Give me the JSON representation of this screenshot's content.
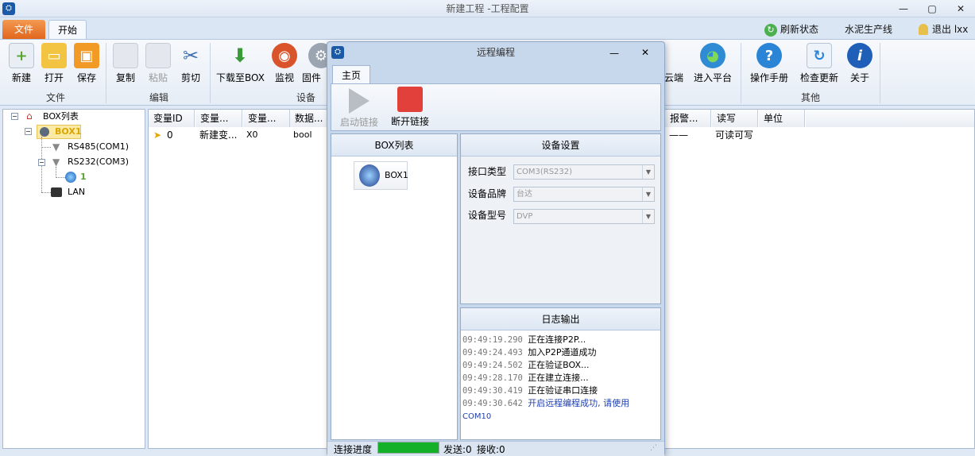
{
  "window": {
    "title": "新建工程 -工程配置"
  },
  "tabs": {
    "file": "文件",
    "start": "开始"
  },
  "right_links": {
    "refresh": "刷新状态",
    "line": "水泥生产线",
    "logout": "退出 lxx"
  },
  "ribbon": {
    "new": "新建",
    "open": "打开",
    "save": "保存",
    "copy": "复制",
    "paste": "粘贴",
    "cut": "剪切",
    "download": "下载至BOX",
    "monitor": "监视",
    "firmware": "固件",
    "cloud": "云端",
    "enter_platform": "进入平台",
    "manual": "操作手册",
    "check_update": "检查更新",
    "about": "关于",
    "group_file": "文件",
    "group_edit": "编辑",
    "group_device": "设备",
    "group_other": "其他"
  },
  "tree": {
    "root": "BOX列表",
    "box1": "BOX1",
    "rs485": "RS485(COM1)",
    "rs232": "RS232(COM3)",
    "device1": "1",
    "lan": "LAN"
  },
  "table": {
    "headers": [
      "变量ID",
      "变量...",
      "变量...",
      "数据...",
      "报警...",
      "读写",
      "单位"
    ],
    "row": {
      "id": "0",
      "name": "新建变...",
      "addr": "X0",
      "type": "bool",
      "alarm": "——",
      "rw": "可读可写"
    }
  },
  "dialog": {
    "title": "远程编程",
    "tab": "主页",
    "start_link": "启动链接",
    "stop_link": "断开链接",
    "box_list_title": "BOX列表",
    "box_item": "BOX1",
    "settings_title": "设备设置",
    "port_label": "接口类型",
    "port_value": "COM3(RS232)",
    "brand_label": "设备品牌",
    "brand_value": "台达",
    "model_label": "设备型号",
    "model_value": "DVP",
    "log_title": "日志输出",
    "logs": [
      {
        "time": "09:49:19.290",
        "msg": "正在连接P2P..."
      },
      {
        "time": "09:49:24.493",
        "msg": "加入P2P通道成功"
      },
      {
        "time": "09:49:24.502",
        "msg": "正在验证BOX..."
      },
      {
        "time": "09:49:28.170",
        "msg": "正在建立连接..."
      },
      {
        "time": "09:49:30.419",
        "msg": "正在验证串口连接"
      },
      {
        "time": "09:49:30.642",
        "msg": "开启远程编程成功, 请使用"
      },
      {
        "time": "",
        "msg": "COM10"
      }
    ],
    "progress_label": "连接进度",
    "progress": 1.0,
    "sent": "发送:0",
    "recv": "接收:0"
  }
}
